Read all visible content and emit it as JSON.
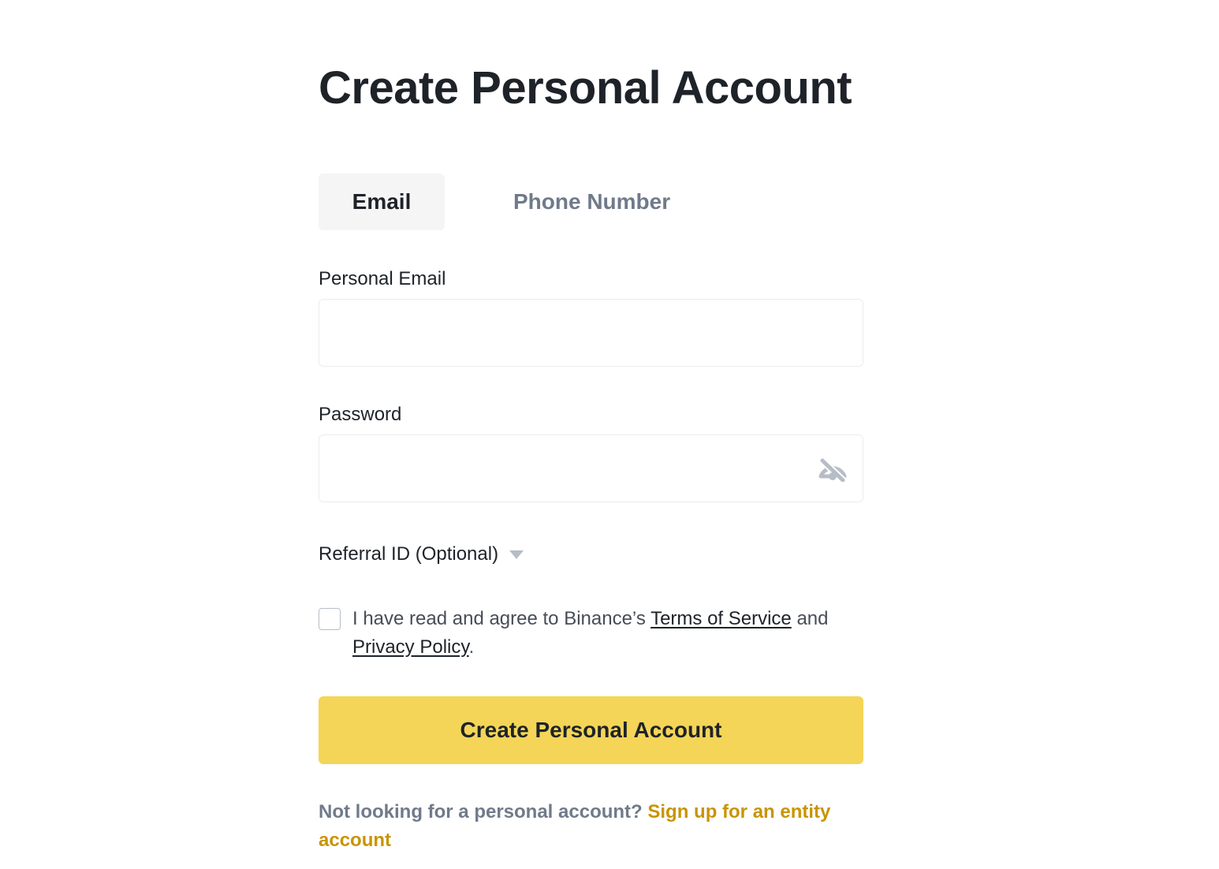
{
  "page": {
    "title": "Create Personal Account"
  },
  "tabs": [
    {
      "label": "Email",
      "active": true
    },
    {
      "label": "Phone Number",
      "active": false
    }
  ],
  "form": {
    "email": {
      "label": "Personal Email",
      "value": "",
      "placeholder": ""
    },
    "password": {
      "label": "Password",
      "value": "",
      "placeholder": "",
      "visibility_icon": "eye-slash-icon"
    },
    "referral": {
      "label": "Referral ID (Optional)",
      "icon": "caret-down-icon"
    },
    "agreement": {
      "checked": false,
      "text_prefix": "I have read and agree to Binance’s ",
      "terms_link": "Terms of Service",
      "text_middle": " and ",
      "privacy_link": "Privacy Policy",
      "text_suffix": "."
    },
    "submit_label": "Create Personal Account"
  },
  "footer": {
    "prompt": "Not looking for a personal account? ",
    "entity_link": "Sign up for an entity account"
  },
  "colors": {
    "primary_button": "#f5d557",
    "link_accent": "#c99400",
    "text_primary": "#1e2329",
    "text_secondary": "#707a8a"
  }
}
